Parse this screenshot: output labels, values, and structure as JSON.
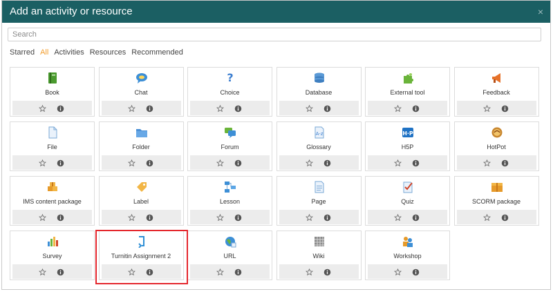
{
  "dialog": {
    "title": "Add an activity or resource",
    "close_glyph": "×"
  },
  "search": {
    "placeholder": "Search",
    "value": ""
  },
  "tabs": [
    {
      "label": "Starred",
      "active": false
    },
    {
      "label": "All",
      "active": true
    },
    {
      "label": "Activities",
      "active": false
    },
    {
      "label": "Resources",
      "active": false
    },
    {
      "label": "Recommended",
      "active": false
    }
  ],
  "items": [
    {
      "label": "Book",
      "icon": "book-icon"
    },
    {
      "label": "Chat",
      "icon": "chat-icon"
    },
    {
      "label": "Choice",
      "icon": "choice-icon"
    },
    {
      "label": "Database",
      "icon": "database-icon"
    },
    {
      "label": "External tool",
      "icon": "puzzle-icon"
    },
    {
      "label": "Feedback",
      "icon": "megaphone-icon"
    },
    {
      "label": "File",
      "icon": "file-icon"
    },
    {
      "label": "Folder",
      "icon": "folder-icon"
    },
    {
      "label": "Forum",
      "icon": "forum-icon"
    },
    {
      "label": "Glossary",
      "icon": "glossary-icon"
    },
    {
      "label": "H5P",
      "icon": "h5p-icon"
    },
    {
      "label": "HotPot",
      "icon": "hotpot-icon"
    },
    {
      "label": "IMS content package",
      "icon": "package-icon"
    },
    {
      "label": "Label",
      "icon": "label-tag-icon"
    },
    {
      "label": "Lesson",
      "icon": "lesson-icon"
    },
    {
      "label": "Page",
      "icon": "page-icon"
    },
    {
      "label": "Quiz",
      "icon": "quiz-icon"
    },
    {
      "label": "SCORM package",
      "icon": "scorm-icon"
    },
    {
      "label": "Survey",
      "icon": "survey-chart-icon"
    },
    {
      "label": "Turnitin Assignment 2",
      "icon": "turnitin-icon"
    },
    {
      "label": "URL",
      "icon": "url-globe-icon"
    },
    {
      "label": "Wiki",
      "icon": "wiki-icon"
    },
    {
      "label": "Workshop",
      "icon": "workshop-icon"
    }
  ],
  "highlighted_item": "Turnitin Assignment 2",
  "colors": {
    "header_bg": "#1b5f63",
    "tab_active": "#f29e2f",
    "highlight_border": "#e4262c"
  }
}
